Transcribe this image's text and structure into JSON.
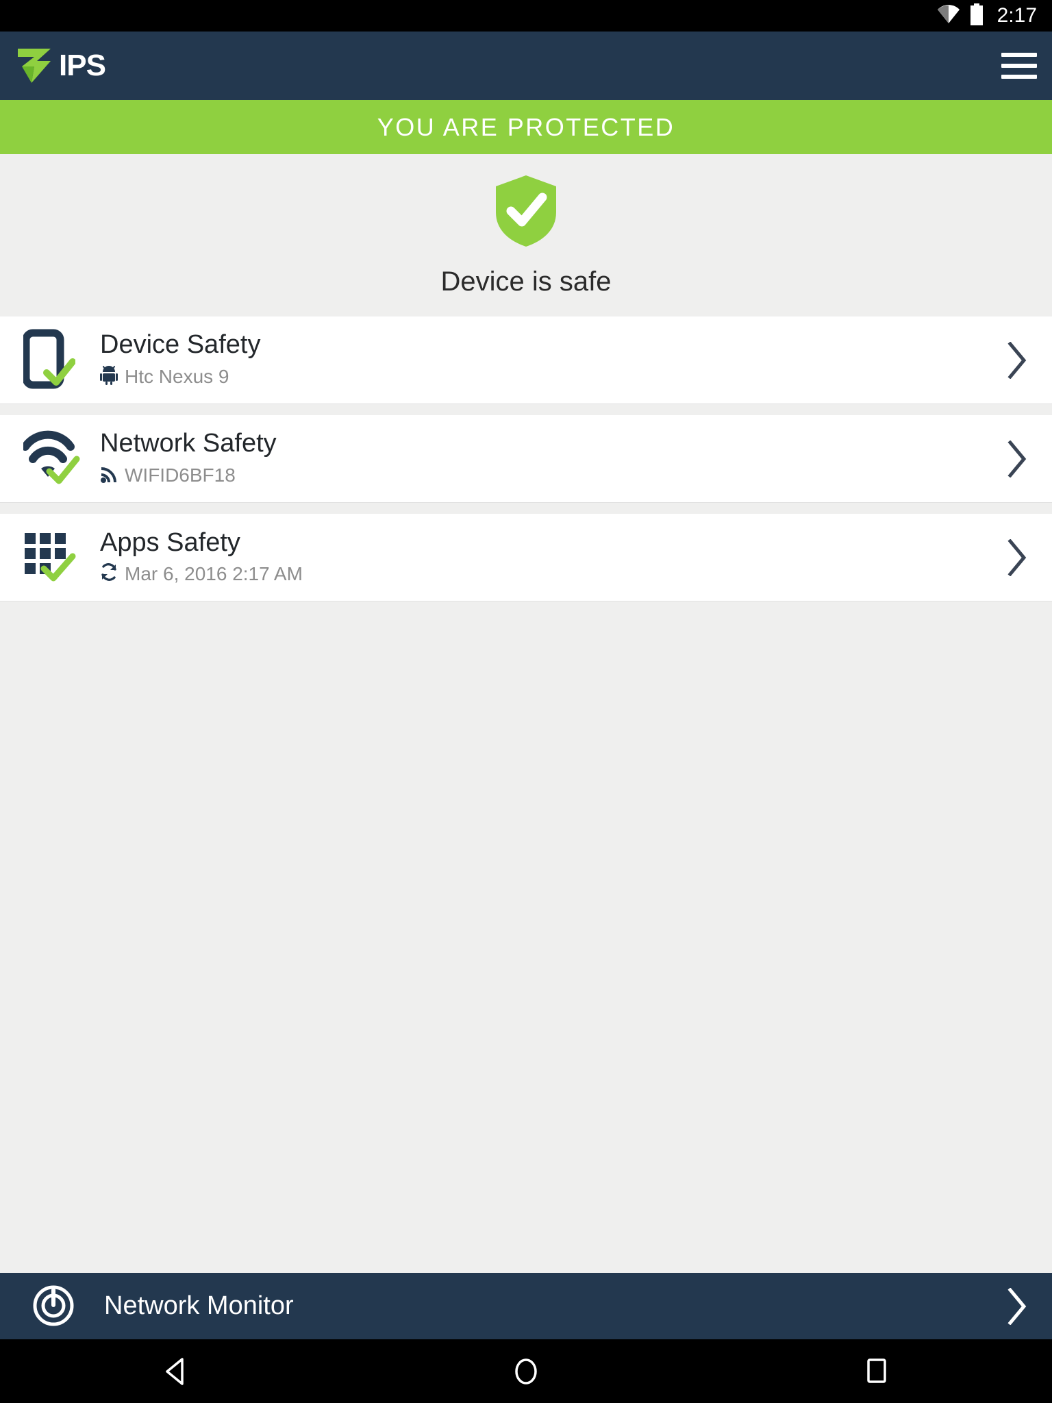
{
  "status_bar": {
    "time": "2:17",
    "wifi_icon": "wifi-icon",
    "battery_icon": "battery-icon"
  },
  "app_bar": {
    "brand_text": "IPS",
    "logo_icon": "zimperium-z-logo-icon",
    "menu_icon": "hamburger-menu-icon",
    "background_color": "#23384f"
  },
  "banner": {
    "text": "YOU ARE PROTECTED",
    "background_color": "#8fd040",
    "text_color": "#ffffff"
  },
  "hero": {
    "shield_icon": "shield-check-icon",
    "caption": "Device is safe",
    "shield_color": "#8fd040"
  },
  "rows": [
    {
      "title": "Device Safety",
      "subtitle": "Htc Nexus 9",
      "icon": "phone-check-icon",
      "sub_icon": "android-robot-icon",
      "chevron_icon": "chevron-right-icon"
    },
    {
      "title": "Network Safety",
      "subtitle": "WIFID6BF18",
      "icon": "wifi-check-icon",
      "sub_icon": "signal-waves-icon",
      "chevron_icon": "chevron-right-icon"
    },
    {
      "title": "Apps Safety",
      "subtitle": "Mar 6, 2016 2:17 AM",
      "icon": "apps-grid-check-icon",
      "sub_icon": "refresh-sync-icon",
      "chevron_icon": "chevron-right-icon"
    }
  ],
  "monitor_bar": {
    "label": "Network Monitor",
    "icon": "radar-target-icon",
    "chevron_icon": "chevron-right-icon"
  },
  "nav_bar": {
    "back_icon": "back-triangle-icon",
    "home_icon": "home-circle-icon",
    "recents_icon": "recents-square-icon"
  },
  "colors": {
    "accent_green": "#8fd040",
    "header_navy": "#23384f",
    "page_bg": "#efefee",
    "row_bg": "#ffffff"
  }
}
